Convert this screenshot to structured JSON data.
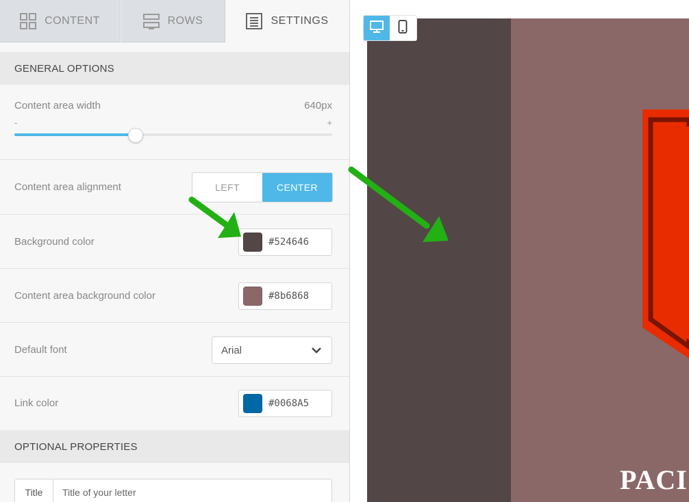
{
  "tabs": [
    {
      "label": "CONTENT",
      "icon": "grid-icon",
      "active": false
    },
    {
      "label": "ROWS",
      "icon": "rows-icon",
      "active": false
    },
    {
      "label": "SETTINGS",
      "icon": "settings-list-icon",
      "active": true
    }
  ],
  "general": {
    "header": "GENERAL OPTIONS",
    "content_width": {
      "label": "Content area width",
      "value": "640px",
      "min_label": "-",
      "max_label": "+",
      "slider_fraction": 0.38
    },
    "alignment": {
      "label": "Content area alignment",
      "options": [
        "LEFT",
        "CENTER"
      ],
      "selected": "CENTER"
    },
    "background_color": {
      "label": "Background color",
      "value": "#524646"
    },
    "content_bg_color": {
      "label": "Content area background color",
      "value": "#8b6868"
    },
    "default_font": {
      "label": "Default font",
      "value": "Arial"
    },
    "link_color": {
      "label": "Link color",
      "value": "#0068A5"
    }
  },
  "optional": {
    "header": "OPTIONAL PROPERTIES",
    "title_addon": "Title",
    "title_placeholder": "Title of your letter"
  },
  "preview": {
    "view_modes": [
      "desktop-icon",
      "mobile-icon"
    ],
    "active_view": "desktop",
    "visible_text": "PACI",
    "colors": {
      "outer": "#524646",
      "content": "#8b6868",
      "badge": "#e82c00",
      "badge_border": "#8a1a00",
      "accent": "#4fb8e8",
      "arrow": "#22b014"
    }
  }
}
